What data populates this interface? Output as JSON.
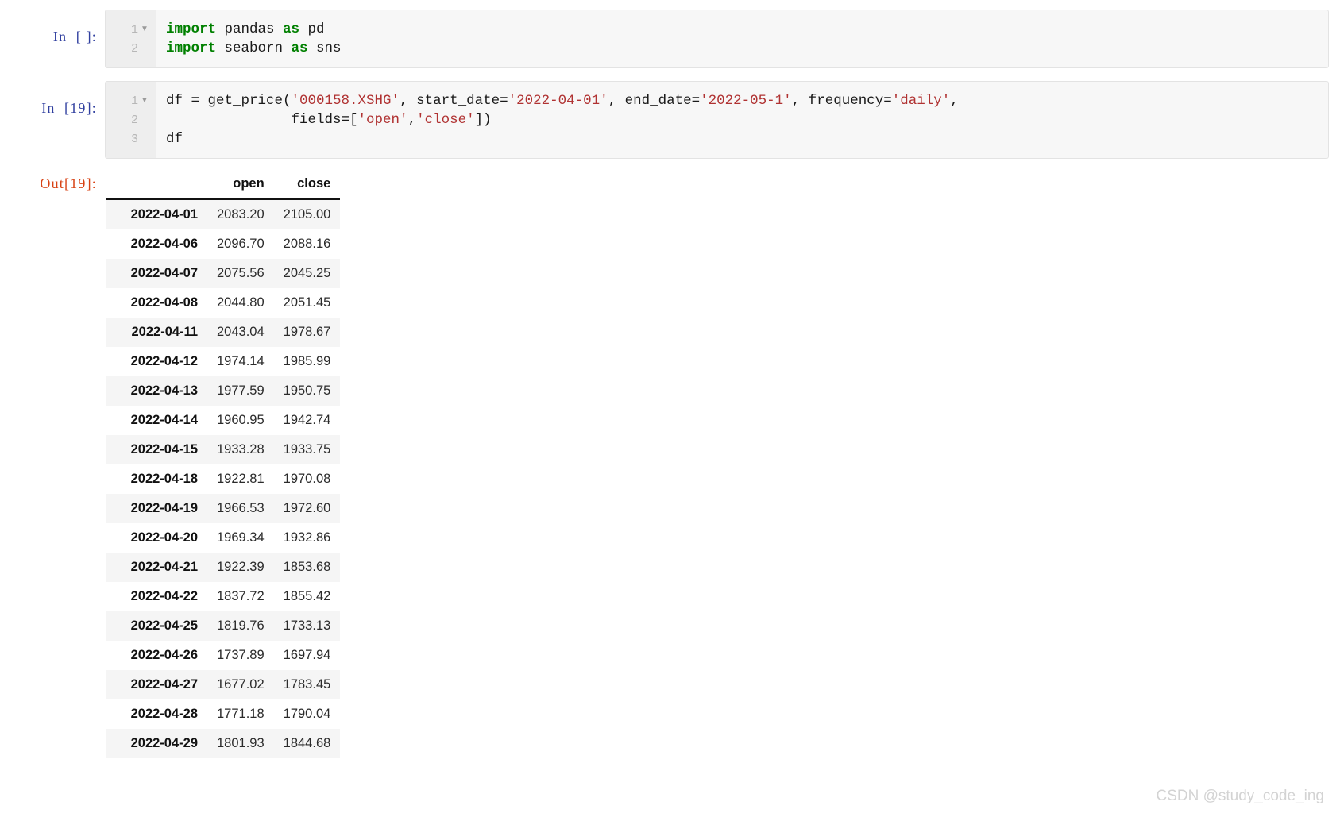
{
  "notebook": {
    "cells": [
      {
        "type": "code",
        "prompt": "In  [ ]:",
        "linenos": [
          "1",
          "2"
        ],
        "fold_glyph": "▼",
        "lines": [
          [
            {
              "t": "import",
              "c": "k"
            },
            {
              "t": " pandas ",
              "c": "n"
            },
            {
              "t": "as",
              "c": "k"
            },
            {
              "t": " pd",
              "c": "n"
            }
          ],
          [
            {
              "t": "import",
              "c": "k"
            },
            {
              "t": " seaborn ",
              "c": "n"
            },
            {
              "t": "as",
              "c": "k"
            },
            {
              "t": " sns",
              "c": "n"
            }
          ]
        ]
      },
      {
        "type": "code",
        "prompt": "In  [19]:",
        "linenos": [
          "1",
          "2",
          "3"
        ],
        "fold_glyph": "▼",
        "lines": [
          [
            {
              "t": "df = get_price(",
              "c": "n"
            },
            {
              "t": "'000158.XSHG'",
              "c": "s"
            },
            {
              "t": ", start_date=",
              "c": "n"
            },
            {
              "t": "'2022-04-01'",
              "c": "s"
            },
            {
              "t": ", end_date=",
              "c": "n"
            },
            {
              "t": "'2022-05-1'",
              "c": "s"
            },
            {
              "t": ", frequency=",
              "c": "n"
            },
            {
              "t": "'daily'",
              "c": "s"
            },
            {
              "t": ",",
              "c": "n"
            }
          ],
          [
            {
              "t": "               fields=[",
              "c": "n"
            },
            {
              "t": "'open'",
              "c": "s"
            },
            {
              "t": ",",
              "c": "n"
            },
            {
              "t": "'close'",
              "c": "s"
            },
            {
              "t": "])",
              "c": "n"
            }
          ],
          [
            {
              "t": "df",
              "c": "n"
            }
          ]
        ]
      }
    ],
    "output": {
      "prompt": "Out[19]:",
      "table": {
        "index_header": "",
        "columns": [
          "open",
          "close"
        ],
        "index": [
          "2022-04-01",
          "2022-04-06",
          "2022-04-07",
          "2022-04-08",
          "2022-04-11",
          "2022-04-12",
          "2022-04-13",
          "2022-04-14",
          "2022-04-15",
          "2022-04-18",
          "2022-04-19",
          "2022-04-20",
          "2022-04-21",
          "2022-04-22",
          "2022-04-25",
          "2022-04-26",
          "2022-04-27",
          "2022-04-28",
          "2022-04-29"
        ],
        "rows": [
          [
            "2083.20",
            "2105.00"
          ],
          [
            "2096.70",
            "2088.16"
          ],
          [
            "2075.56",
            "2045.25"
          ],
          [
            "2044.80",
            "2051.45"
          ],
          [
            "2043.04",
            "1978.67"
          ],
          [
            "1974.14",
            "1985.99"
          ],
          [
            "1977.59",
            "1950.75"
          ],
          [
            "1960.95",
            "1942.74"
          ],
          [
            "1933.28",
            "1933.75"
          ],
          [
            "1922.81",
            "1970.08"
          ],
          [
            "1966.53",
            "1972.60"
          ],
          [
            "1969.34",
            "1932.86"
          ],
          [
            "1922.39",
            "1853.68"
          ],
          [
            "1837.72",
            "1855.42"
          ],
          [
            "1819.76",
            "1733.13"
          ],
          [
            "1737.89",
            "1697.94"
          ],
          [
            "1677.02",
            "1783.45"
          ],
          [
            "1771.18",
            "1790.04"
          ],
          [
            "1801.93",
            "1844.68"
          ]
        ]
      }
    }
  },
  "watermark": {
    "text": "CSDN @study_code_ing"
  },
  "colors": {
    "keyword": "#008000",
    "string": "#b03232",
    "in_prompt": "#303f9f",
    "out_prompt": "#d84315",
    "cell_bg": "#f7f7f7",
    "gutter_bg": "#eeeeee",
    "row_stripe": "#f5f5f5"
  }
}
